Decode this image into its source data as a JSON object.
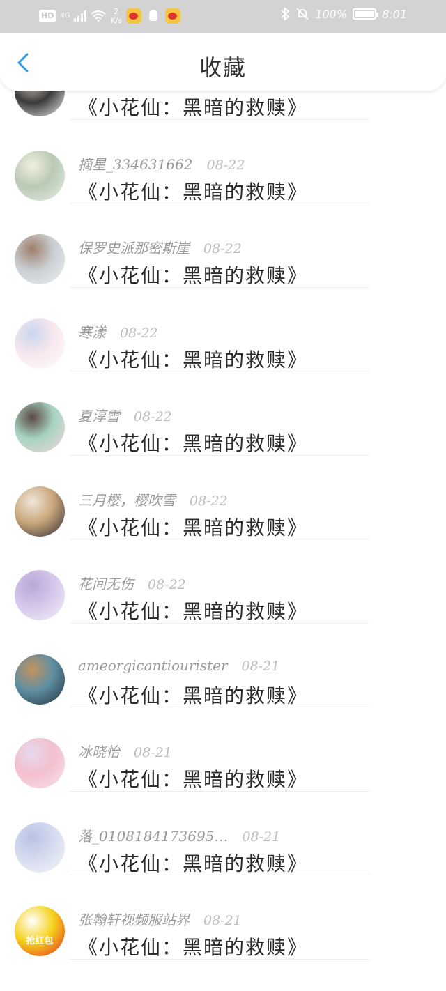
{
  "status_bar": {
    "hd": "HD",
    "network": "4G",
    "speed_value": "2",
    "speed_unit": "K/s",
    "battery_percent": "100%",
    "time": "8:01",
    "icons": [
      "hd-icon",
      "signal-icon",
      "wifi-icon",
      "weibo-icon",
      "qq-icon",
      "weibo-icon",
      "bluetooth-icon",
      "mute-icon",
      "battery-icon"
    ]
  },
  "header": {
    "title": "收藏",
    "back_icon": "chevron-left-icon",
    "accent": "#2b9ae8"
  },
  "list": [
    {
      "name": "",
      "date": "",
      "title": "《小花仙：黑暗的救赎》",
      "avatar_colors": [
        "#f2efec",
        "#3a3a3a",
        "#d9cfc6"
      ]
    },
    {
      "name": "摘星_334631662",
      "date": "08-22",
      "title": "《小花仙：黑暗的救赎》",
      "avatar_colors": [
        "#e8efe6",
        "#b9c9b4",
        "#f2f0e0"
      ]
    },
    {
      "name": "保罗史派那密斯崖",
      "date": "08-22",
      "title": "《小花仙：黑暗的救赎》",
      "avatar_colors": [
        "#eef1f3",
        "#c8ced2",
        "#a07f6a"
      ]
    },
    {
      "name": "寒漾",
      "date": "08-22",
      "title": "《小花仙：黑暗的救赎》",
      "avatar_colors": [
        "#ffffff",
        "#f7e6ee",
        "#c9d7ef"
      ]
    },
    {
      "name": "夏淳雪",
      "date": "08-22",
      "title": "《小花仙：黑暗的救赎》",
      "avatar_colors": [
        "#f3d7d9",
        "#a7d3c2",
        "#5b4a43"
      ]
    },
    {
      "name": "三月樱，樱吹雪",
      "date": "08-22",
      "title": "《小花仙：黑暗的救赎》",
      "avatar_colors": [
        "#2e2a33",
        "#c9a77a",
        "#f1e6dc"
      ]
    },
    {
      "name": "花间无伤",
      "date": "08-22",
      "title": "《小花仙：黑暗的救赎》",
      "avatar_colors": [
        "#f4f0f8",
        "#d5c6ea",
        "#b9a7d9"
      ]
    },
    {
      "name": "ameorgicantiourister",
      "date": "08-21",
      "title": "《小花仙：黑暗的救赎》",
      "avatar_colors": [
        "#22313a",
        "#5f8fa3",
        "#c3925e"
      ]
    },
    {
      "name": "冰晓怡",
      "date": "08-21",
      "title": "《小花仙：黑暗的救赎》",
      "avatar_colors": [
        "#fbe4ea",
        "#f2bfcd",
        "#e8d9f0"
      ]
    },
    {
      "name": "落_0108184173695…",
      "date": "08-21",
      "title": "《小花仙：黑暗的救赎》",
      "avatar_colors": [
        "#f5f6fb",
        "#d5dbee",
        "#b8c3e6"
      ]
    },
    {
      "name": "张翰轩视频服站界",
      "date": "08-21",
      "title": "《小花仙：黑暗的救赎》",
      "avatar_colors": [
        "#e62a1e",
        "#f5d21d",
        "#ffffff"
      ],
      "avatar_text": "抢红包"
    }
  ]
}
